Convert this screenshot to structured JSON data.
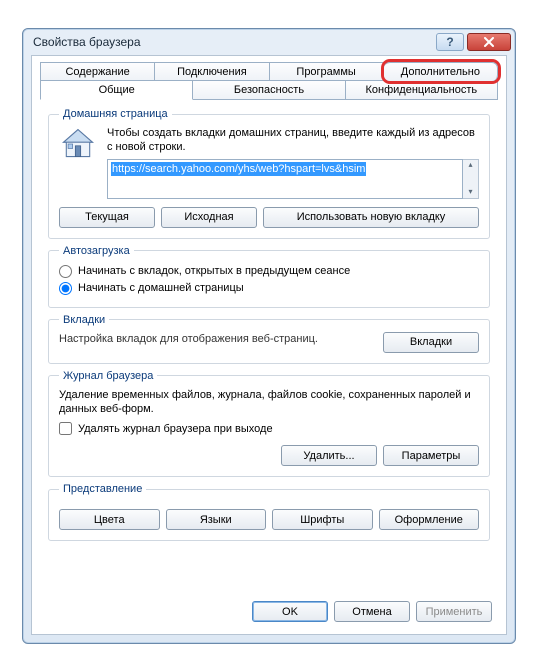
{
  "window": {
    "title": "Свойства браузера"
  },
  "tabs": {
    "row1": [
      "Содержание",
      "Подключения",
      "Программы",
      "Дополнительно"
    ],
    "row2": [
      "Общие",
      "Безопасность",
      "Конфиденциальность"
    ],
    "active": "Общие",
    "highlighted": "Дополнительно"
  },
  "homepage": {
    "legend": "Домашняя страница",
    "instruction": "Чтобы создать вкладки домашних страниц, введите каждый из адресов с новой строки.",
    "url": "https://search.yahoo.com/yhs/web?hspart=lvs&hsim",
    "buttons": {
      "current": "Текущая",
      "default": "Исходная",
      "newtab": "Использовать новую вкладку"
    }
  },
  "startup": {
    "legend": "Автозагрузка",
    "option_tabs": "Начинать с вкладок, открытых в предыдущем сеансе",
    "option_home": "Начинать с домашней страницы",
    "selected": "home"
  },
  "tabs_section": {
    "legend": "Вкладки",
    "desc": "Настройка вкладок для отображения веб-страниц.",
    "button": "Вкладки"
  },
  "history": {
    "legend": "Журнал браузера",
    "desc": "Удаление временных файлов, журнала, файлов cookie, сохраненных паролей и данных веб-форм.",
    "checkbox": "Удалять журнал браузера при выходе",
    "delete_btn": "Удалить...",
    "settings_btn": "Параметры"
  },
  "appearance": {
    "legend": "Представление",
    "colors": "Цвета",
    "languages": "Языки",
    "fonts": "Шрифты",
    "accessibility": "Оформление"
  },
  "footer": {
    "ok": "OK",
    "cancel": "Отмена",
    "apply": "Применить"
  }
}
